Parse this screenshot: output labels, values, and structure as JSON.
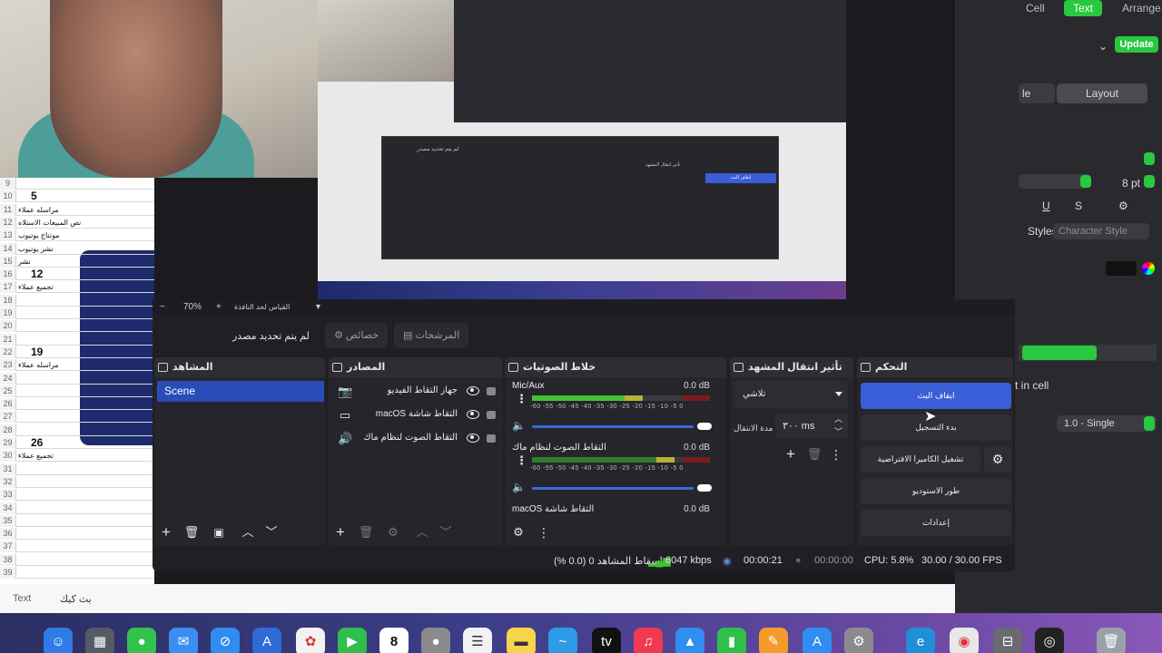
{
  "nested_preview_labels": {
    "stop": "ايقاف البث",
    "transition": "تأثير انتقال المشهد",
    "no_source": "لم يتم تحديد مصدر"
  },
  "spreadsheet": {
    "rows": [
      {
        "n": "9",
        "text": ""
      },
      {
        "n": "10",
        "text": "5",
        "big": true
      },
      {
        "n": "11",
        "text": "مراسله عملاء"
      },
      {
        "n": "12",
        "text": "نص المبيعات الاستلاه"
      },
      {
        "n": "13",
        "text": "مونتاج يوتيوب"
      },
      {
        "n": "14",
        "text": "نشر يوتيوب"
      },
      {
        "n": "15",
        "text": "نشر"
      },
      {
        "n": "16",
        "text": "12",
        "big": true
      },
      {
        "n": "17",
        "text": "تجميع عملاء"
      },
      {
        "n": "18",
        "text": ""
      },
      {
        "n": "19",
        "text": ""
      },
      {
        "n": "20",
        "text": ""
      },
      {
        "n": "21",
        "text": ""
      },
      {
        "n": "22",
        "text": "19",
        "big": true
      },
      {
        "n": "23",
        "text": "مراسله عملاء"
      },
      {
        "n": "24",
        "text": ""
      },
      {
        "n": "25",
        "text": ""
      },
      {
        "n": "26",
        "text": ""
      },
      {
        "n": "27",
        "text": ""
      },
      {
        "n": "28",
        "text": ""
      },
      {
        "n": "29",
        "text": "26",
        "big": true
      },
      {
        "n": "30",
        "text": "تجميع عملاء"
      },
      {
        "n": "31",
        "text": ""
      },
      {
        "n": "32",
        "text": ""
      },
      {
        "n": "33",
        "text": ""
      },
      {
        "n": "34",
        "text": ""
      },
      {
        "n": "35",
        "text": ""
      },
      {
        "n": "36",
        "text": ""
      },
      {
        "n": "37",
        "text": ""
      },
      {
        "n": "38",
        "text": ""
      },
      {
        "n": "39",
        "text": ""
      }
    ]
  },
  "below_strip": {
    "text_label": "Text",
    "hint": "بث كيك"
  },
  "pages_panel": {
    "tabs": [
      "Cell",
      "Text",
      "Arrange"
    ],
    "update": "Update",
    "layout_tab": "Layout",
    "style_tab": "le",
    "font_size": "8 pt",
    "underline": "U",
    "strike": "S",
    "styles_label": "Styles",
    "char_style": "Character Style",
    "text_in_cell": "xt in cell",
    "line_spacing": "1.0 - Single"
  },
  "obs": {
    "zoom": {
      "minus": "−",
      "value": "70%",
      "plus": "+",
      "fit": "القياس لحد النافذة"
    },
    "source_toolbar": {
      "no_source": "لم يتم تحديد مصدر",
      "properties": "خصائص",
      "filters": "المرشحات"
    },
    "scenes": {
      "title": "المشاهد",
      "items": [
        "Scene"
      ]
    },
    "sources": {
      "title": "المصادر",
      "items": [
        {
          "icon": "camera",
          "name": "جهاز التقاط الفيديو"
        },
        {
          "icon": "display",
          "name": "macOS التقاط شاشة"
        },
        {
          "icon": "speaker",
          "name": "التقاط الصوت لنظام ماك"
        }
      ]
    },
    "mixer": {
      "title": "خلاط الصوتيات",
      "scale": "-60 -55 -50 -45 -40 -35 -30 -25 -20 -15 -10 -5 0",
      "channels": [
        {
          "name": "Mic/Aux",
          "db": "0.0 dB",
          "level": 0.52,
          "peak": 0.62,
          "volume": 1.0
        },
        {
          "name": "التقاط الصوت لنظام ماك",
          "db": "0.0 dB",
          "level": 0.7,
          "peak": 0.8,
          "volume": 1.0
        },
        {
          "name": "macOS التقاط شاشة",
          "db": "0.0 dB"
        }
      ]
    },
    "transitions": {
      "title": "تأثير انتقال المشهد",
      "type": "تلاشي",
      "duration_label": "مدة الانتقال",
      "duration": "٣٠٠ ms"
    },
    "controls": {
      "title": "التحكم",
      "stop_stream": "ايقاف البث",
      "start_recording": "بدء التسجيل",
      "virtual_camera": "تشغيل الكاميرا الافتراضية",
      "studio_mode": "طور الاستوديو",
      "settings": "إعدادات"
    },
    "status": {
      "dropped": "إسقاط المشاهد 0 (0.0 %)",
      "bitrate": "6047 kbps",
      "stream_time": "00:00:21",
      "rec_time": "00:00:00",
      "cpu": "CPU: 5.8%",
      "fps": "30.00 / 30.00 FPS"
    }
  },
  "dock": {
    "apps": [
      "finder",
      "launchpad",
      "messages",
      "mail",
      "safari",
      "compass",
      "photos",
      "facetime",
      "calendar",
      "contacts",
      "reminders",
      "notes",
      "freeform",
      "tv",
      "music",
      "keynote",
      "numbers",
      "pages",
      "app-store",
      "system-settings",
      "edge",
      "chrome",
      "disk",
      "obs",
      "trash"
    ],
    "calendar_day": "8"
  },
  "colors": {
    "accent": "#3a5ed8",
    "scene_selected": "#284cb8",
    "meter_green": "#44c234",
    "pages_green": "#28c840"
  }
}
